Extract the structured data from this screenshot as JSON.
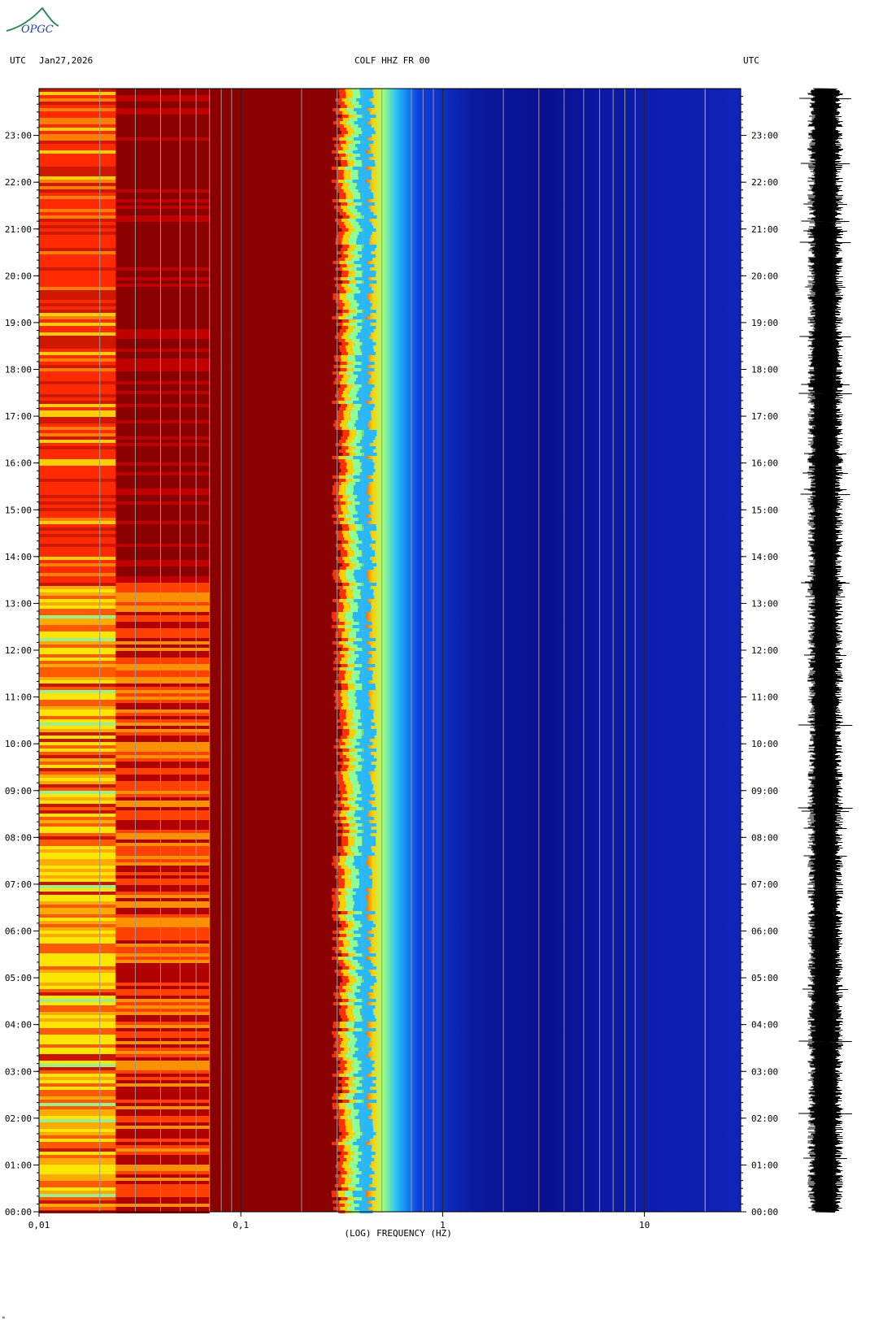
{
  "header": {
    "logo_text": "OPGC",
    "left_tz": "UTC",
    "date": "Jan27,2026",
    "station": "COLF HHZ FR 00",
    "right_tz": "UTC"
  },
  "footnote": "ᵐ",
  "colors": {
    "very_low": "#0a0f8c",
    "low": "#1e3cd8",
    "mid": "#20b0ff",
    "mid_high": "#7fffbf",
    "high": "#ffe000",
    "very_high": "#ff3000",
    "max": "#8b0000"
  },
  "chart_data": {
    "type": "heatmap",
    "title": "COLF HHZ FR 00",
    "xlabel": "(LOG) FREQUENCY (HZ)",
    "ylabel": "UTC",
    "x_scale": "log",
    "xlim": [
      0.01,
      30
    ],
    "x_ticks": [
      {
        "value": 0.01,
        "label": "0,01"
      },
      {
        "value": 0.1,
        "label": "0,1"
      },
      {
        "value": 1,
        "label": "1"
      },
      {
        "value": 10,
        "label": "10"
      }
    ],
    "y_ticks": [
      "00:00",
      "01:00",
      "02:00",
      "03:00",
      "04:00",
      "05:00",
      "06:00",
      "07:00",
      "08:00",
      "09:00",
      "10:00",
      "11:00",
      "12:00",
      "13:00",
      "14:00",
      "15:00",
      "16:00",
      "17:00",
      "18:00",
      "19:00",
      "20:00",
      "21:00",
      "22:00",
      "23:00"
    ],
    "ylim_hours": [
      0,
      24
    ],
    "grid": true,
    "color_scale": [
      "dark blue (low power)",
      "blue",
      "cyan",
      "light green",
      "yellow",
      "red",
      "dark red (high power)"
    ],
    "frequency_bands": [
      {
        "f_min": 0.01,
        "f_max": 0.024,
        "level": "yellow-red, higher power 00:00-14:00, red 14:00-24:00"
      },
      {
        "f_min": 0.024,
        "f_max": 0.07,
        "level": "red-dark red alternating"
      },
      {
        "f_min": 0.07,
        "f_max": 0.3,
        "level": "dark red (maximum)"
      },
      {
        "f_min": 0.3,
        "f_max": 0.65,
        "level": "transition red-yellow-cyan-blue"
      },
      {
        "f_min": 0.65,
        "f_max": 30,
        "level": "blue (low)"
      }
    ],
    "waveform": {
      "label": "trace",
      "time_range": [
        "00:00",
        "24:00"
      ]
    }
  }
}
